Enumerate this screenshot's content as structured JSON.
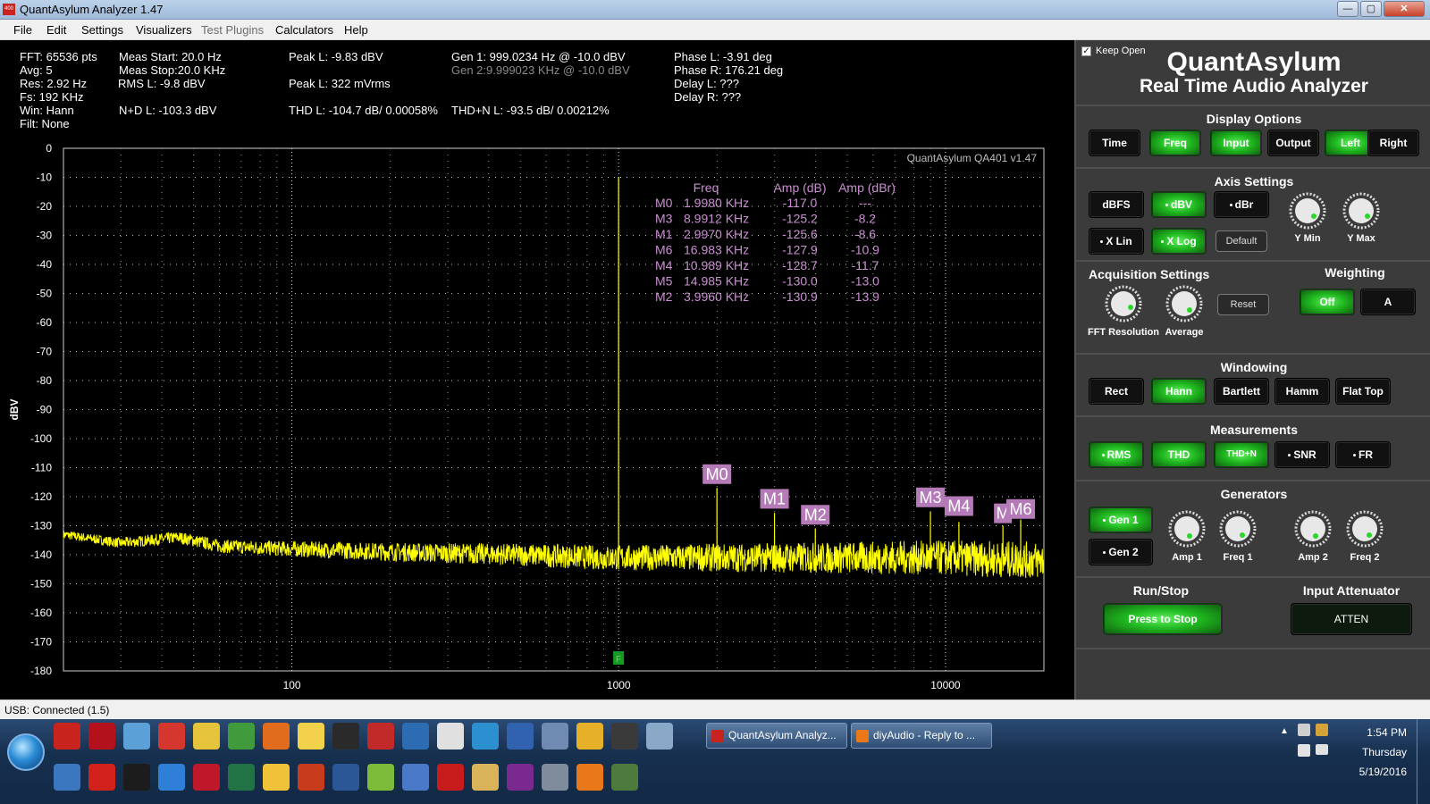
{
  "window": {
    "title": "QuantAsylum Analyzer 1.47",
    "app_icon_text": "400",
    "minimize": "—",
    "maximize": "▢",
    "close": "✕"
  },
  "menu": [
    {
      "label": "File"
    },
    {
      "label": "Edit"
    },
    {
      "label": "Settings"
    },
    {
      "label": "Visualizers"
    },
    {
      "label": "Test Plugins",
      "disabled": true
    },
    {
      "label": "Calculators"
    },
    {
      "label": "Help"
    }
  ],
  "stats": {
    "fft": "FFT: 65536 pts",
    "avg": "Avg: 5",
    "res": "Res: 2.92 Hz",
    "fs": "Fs: 192 KHz",
    "win": "Win: Hann",
    "filt": "Filt: None",
    "meas_start": "Meas Start: 20.0 Hz",
    "meas_stop": "Meas Stop:20.0 KHz",
    "rms_l": "RMS L: -9.8 dBV",
    "nd_l": "N+D L: -103.3 dBV",
    "peak_l_dbv": "Peak L: -9.83 dBV",
    "peak_l_mvrms": "Peak L: 322 mVrms",
    "thd_l": "THD L: -104.7 dB/ 0.00058%",
    "gen1": "Gen 1: 999.0234 Hz @ -10.0  dBV",
    "gen2": "Gen 2:9.999023 KHz @ -10.0  dBV",
    "thdn_l": "THD+N L: -93.5 dB/ 0.00212%",
    "phase_l": "Phase L: -3.91 deg",
    "phase_r": "Phase R: 176.21 deg",
    "delay_l": "Delay L: ???",
    "delay_r": "Delay R: ???"
  },
  "chart_data": {
    "type": "line",
    "title": "",
    "watermark": "QuantAsylum QA401 v1.47",
    "xlabel": "",
    "ylabel": "dBV",
    "x_scale": "log",
    "xlim": [
      20,
      20000
    ],
    "ylim": [
      -180,
      0
    ],
    "yticks": [
      0,
      -10,
      -20,
      -30,
      -40,
      -50,
      -60,
      -70,
      -80,
      -90,
      -100,
      -110,
      -120,
      -130,
      -140,
      -150,
      -160,
      -170,
      -180
    ],
    "xticks": [
      {
        "value": 100,
        "label": "100"
      },
      {
        "value": 1000,
        "label": "1000"
      },
      {
        "value": 10000,
        "label": "10000"
      }
    ],
    "grid": true,
    "series": [
      {
        "color": "#ffff00",
        "noise_floor": [
          [
            20,
            -133
          ],
          [
            30,
            -136
          ],
          [
            45,
            -134
          ],
          [
            60,
            -137
          ],
          [
            100,
            -138
          ],
          [
            200,
            -139
          ],
          [
            500,
            -140
          ],
          [
            900,
            -141
          ],
          [
            1500,
            -141
          ],
          [
            3000,
            -141
          ],
          [
            6000,
            -141
          ],
          [
            10000,
            -141
          ],
          [
            20000,
            -142
          ]
        ],
        "spikes": [
          {
            "x": 999,
            "y": -9.8
          },
          {
            "x": 1998,
            "y": -117.0
          },
          {
            "x": 2997,
            "y": -125.6
          },
          {
            "x": 3996,
            "y": -130.9
          },
          {
            "x": 8991,
            "y": -125.2
          },
          {
            "x": 10989,
            "y": -128.7
          },
          {
            "x": 14985,
            "y": -130.0
          },
          {
            "x": 16983,
            "y": -127.9
          }
        ]
      }
    ],
    "marker_table": {
      "headers": [
        "Freq",
        "Amp (dB)",
        "Amp (dBr)"
      ],
      "rows": [
        {
          "name": "M0",
          "freq": "1.9980 KHz",
          "amp_db": "-117.0",
          "amp_dbr": "---"
        },
        {
          "name": "M3",
          "freq": "8.9912 KHz",
          "amp_db": "-125.2",
          "amp_dbr": "-8.2"
        },
        {
          "name": "M1",
          "freq": "2.9970 KHz",
          "amp_db": "-125.6",
          "amp_dbr": "-8.6"
        },
        {
          "name": "M6",
          "freq": "16.983 KHz",
          "amp_db": "-127.9",
          "amp_dbr": "-10.9"
        },
        {
          "name": "M4",
          "freq": "10.989 KHz",
          "amp_db": "-128.7",
          "amp_dbr": "-11.7"
        },
        {
          "name": "M5",
          "freq": "14.985 KHz",
          "amp_db": "-130.0",
          "amp_dbr": "-13.0"
        },
        {
          "name": "M2",
          "freq": "3.9960 KHz",
          "amp_db": "-130.9",
          "amp_dbr": "-13.9"
        }
      ]
    },
    "marker_labels": [
      {
        "name": "M0",
        "x": 1998,
        "y": -115
      },
      {
        "name": "M1",
        "x": 2997,
        "y": -123.5
      },
      {
        "name": "M2",
        "x": 3996,
        "y": -129
      },
      {
        "name": "M3",
        "x": 8991,
        "y": -123
      },
      {
        "name": "M4",
        "x": 10989,
        "y": -126
      },
      {
        "name": "M",
        "x": 14985,
        "y": -128.5
      },
      {
        "name": "M6",
        "x": 16983,
        "y": -127
      }
    ],
    "fundamental_marker": {
      "label": "F",
      "x": 999
    }
  },
  "panel": {
    "keep_open": "Keep Open",
    "brand_1": "QuantAsylum",
    "brand_2": "Real Time Audio Analyzer",
    "display_options": {
      "title": "Display Options",
      "time": "Time",
      "freq": "Freq",
      "input": "Input",
      "output": "Output",
      "left": "Left",
      "right": "Right"
    },
    "axis_settings": {
      "title": "Axis Settings",
      "dbfs": "dBFS",
      "dbv": "dBV",
      "dbr": "dBr",
      "xlin": "X Lin",
      "xlog": "X Log",
      "default": "Default",
      "ymin": "Y Min",
      "ymax": "Y Max"
    },
    "acquisition": {
      "title": "Acquisition Settings",
      "fft_resolution": "FFT Resolution",
      "average": "Average",
      "reset": "Reset"
    },
    "weighting": {
      "title": "Weighting",
      "off": "Off",
      "a": "A"
    },
    "windowing": {
      "title": "Windowing",
      "rect": "Rect",
      "hann": "Hann",
      "bartlett": "Bartlett",
      "hamm": "Hamm",
      "flattop": "Flat Top"
    },
    "measurements": {
      "title": "Measurements",
      "rms": "RMS",
      "thd": "THD",
      "thdn": "THD+N",
      "snr": "SNR",
      "fr": "FR"
    },
    "generators": {
      "title": "Generators",
      "gen1": "Gen 1",
      "gen2": "Gen 2",
      "amp1": "Amp 1",
      "freq1": "Freq 1",
      "amp2": "Amp 2",
      "freq2": "Freq 2"
    },
    "run_stop": {
      "title": "Run/Stop",
      "button": "Press to Stop"
    },
    "input_attenuator": {
      "title": "Input Attenuator",
      "button": "ATTEN"
    }
  },
  "status": {
    "text": "USB: Connected  (1.5)"
  },
  "taskbar": {
    "windows": [
      {
        "label": "QuantAsylum Analyz...",
        "icon_color": "#c8231c"
      },
      {
        "label": "diyAudio - Reply to ...",
        "icon_color": "#e8781a"
      }
    ],
    "time": "1:54 PM",
    "day": "Thursday",
    "date": "5/19/2016",
    "icons_row1": [
      "acrobat-icon",
      "pdf-icon",
      "network-icon",
      "c64-icon",
      "tool-icon",
      "chart-icon",
      "rocket-icon",
      "duck-icon",
      "terminal-icon",
      "radar-icon",
      "outlook-icon",
      "eagle-icon",
      "kodi-icon",
      "fc-icon",
      "ltspice-icon",
      "chrome-icon",
      "drive-icon",
      "calculator-icon"
    ],
    "icons_row2": [
      "sync-icon",
      "paint-icon",
      "kindle-icon",
      "ie-icon",
      "altium-icon",
      "excel-icon",
      "mail-icon",
      "media-icon",
      "word-icon",
      "games-icon",
      "device-icon",
      "hal-icon",
      "folder-icon",
      "winrar-icon",
      "camera-icon",
      "firefox-icon",
      "synaptics-icon"
    ]
  }
}
